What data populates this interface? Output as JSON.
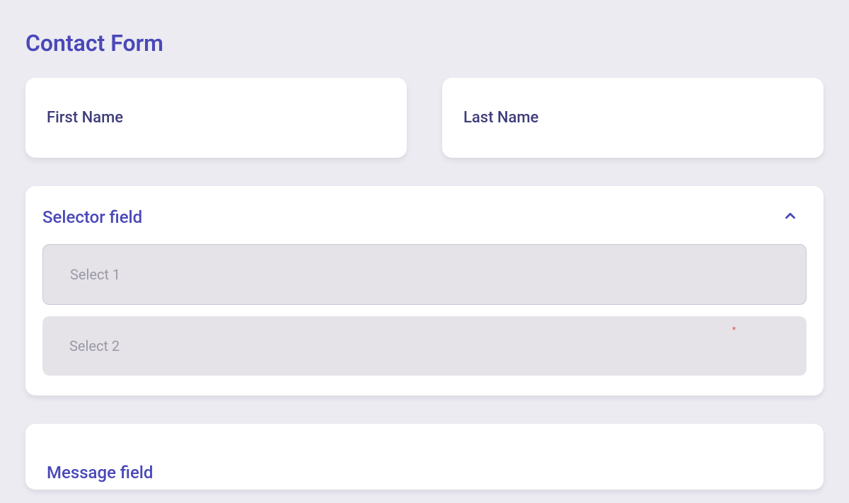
{
  "title": "Contact Form",
  "firstName": {
    "label": "First Name"
  },
  "lastName": {
    "label": "Last Name"
  },
  "selector": {
    "title": "Selector field",
    "options": [
      "Select 1",
      "Select 2"
    ]
  },
  "message": {
    "title": "Message field"
  }
}
